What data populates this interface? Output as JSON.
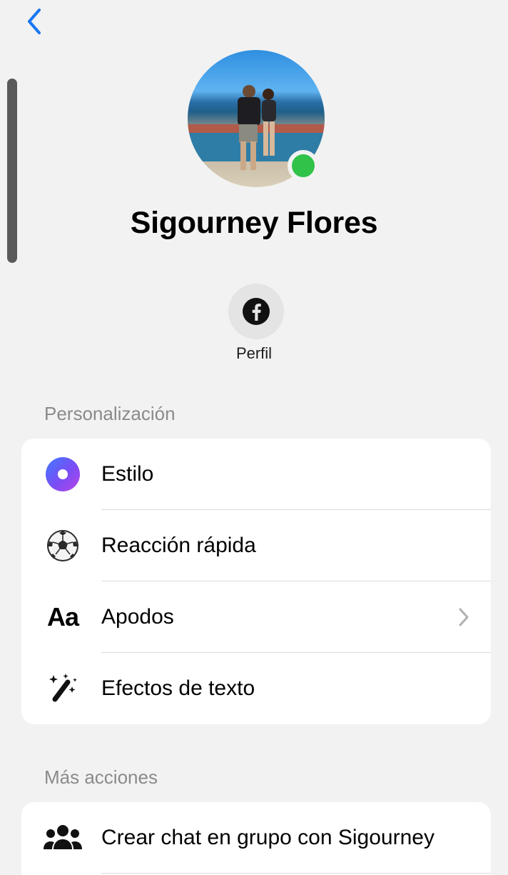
{
  "header": {
    "back_icon": "chevron-left-icon",
    "accent_color": "#1877f2"
  },
  "profile": {
    "name": "Sigourney Flores",
    "online_color": "#31c24a",
    "facebook_label": "Perfil",
    "facebook_icon": "facebook-icon"
  },
  "personalization": {
    "header": "Personalización",
    "items": [
      {
        "label": "Estilo",
        "icon": "theme-dot-icon"
      },
      {
        "label": "Reacción rápida",
        "icon": "soccer-ball-icon"
      },
      {
        "label": "Apodos",
        "icon": "Aa",
        "chevron": true
      },
      {
        "label": "Efectos de texto",
        "icon": "magic-wand-icon"
      }
    ]
  },
  "more_actions": {
    "header": "Más acciones",
    "items": [
      {
        "label": "Crear chat en grupo con Sigourney",
        "icon": "group-icon"
      }
    ]
  }
}
